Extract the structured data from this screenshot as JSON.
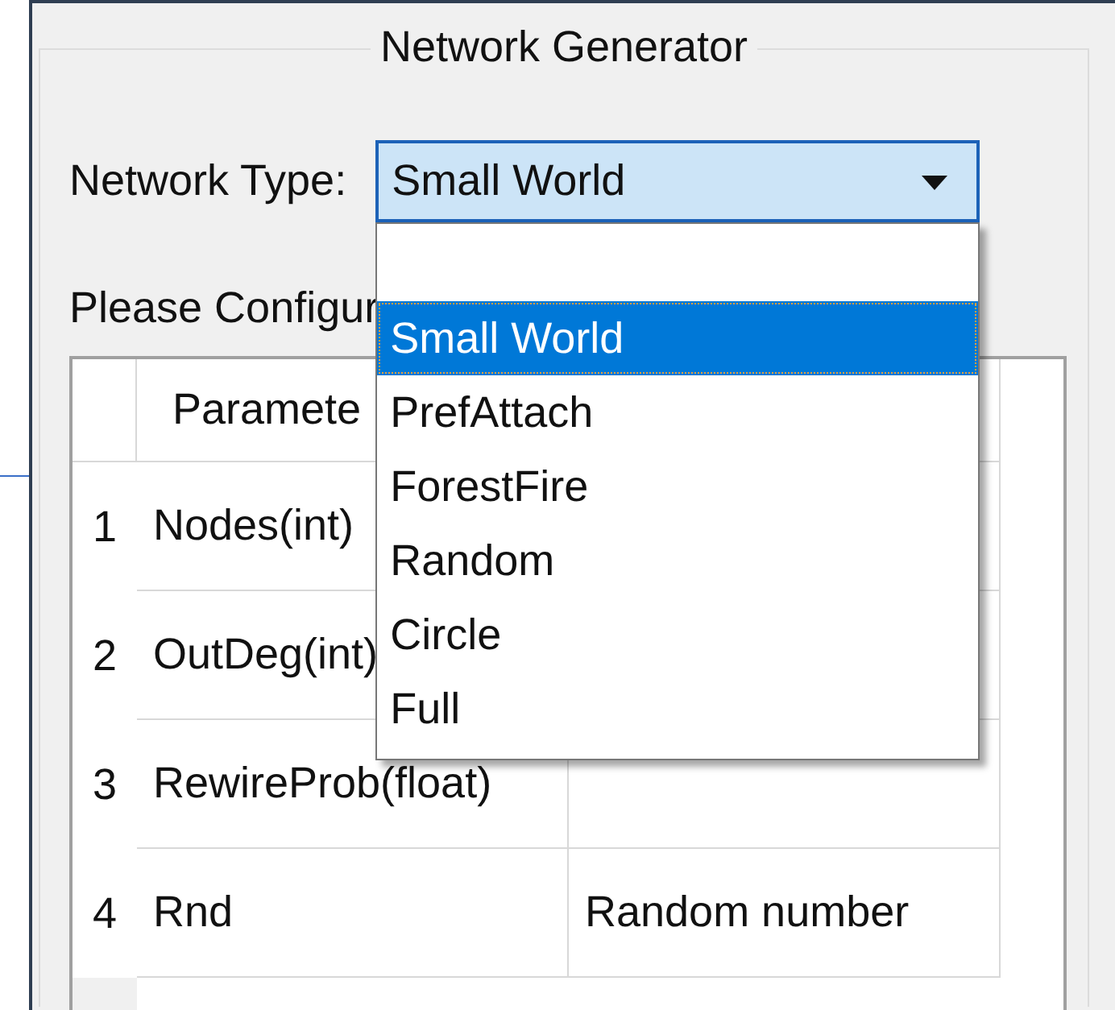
{
  "group": {
    "title": "Network Generator"
  },
  "network_type": {
    "label": "Network Type:",
    "value": "Small World",
    "expanded": true,
    "options": [
      {
        "selected": false
      },
      {
        "label": "Small World",
        "selected": true
      },
      {
        "label": "PrefAttach",
        "selected": false
      },
      {
        "label": "ForestFire",
        "selected": false
      },
      {
        "label": "Random",
        "selected": false
      },
      {
        "label": "Circle",
        "selected": false
      },
      {
        "label": "Full",
        "selected": false
      }
    ]
  },
  "instructions": "Please Configur",
  "table": {
    "columns": [
      "Paramete"
    ],
    "rows": [
      {
        "number": "1",
        "cells": [
          "Nodes(int)"
        ]
      },
      {
        "number": "2",
        "cells": [
          "OutDeg(int)"
        ]
      },
      {
        "number": "3",
        "cells": [
          "RewireProb(float)",
          ""
        ]
      },
      {
        "number": "4",
        "cells": [
          "Rnd",
          "Random number"
        ]
      }
    ]
  }
}
